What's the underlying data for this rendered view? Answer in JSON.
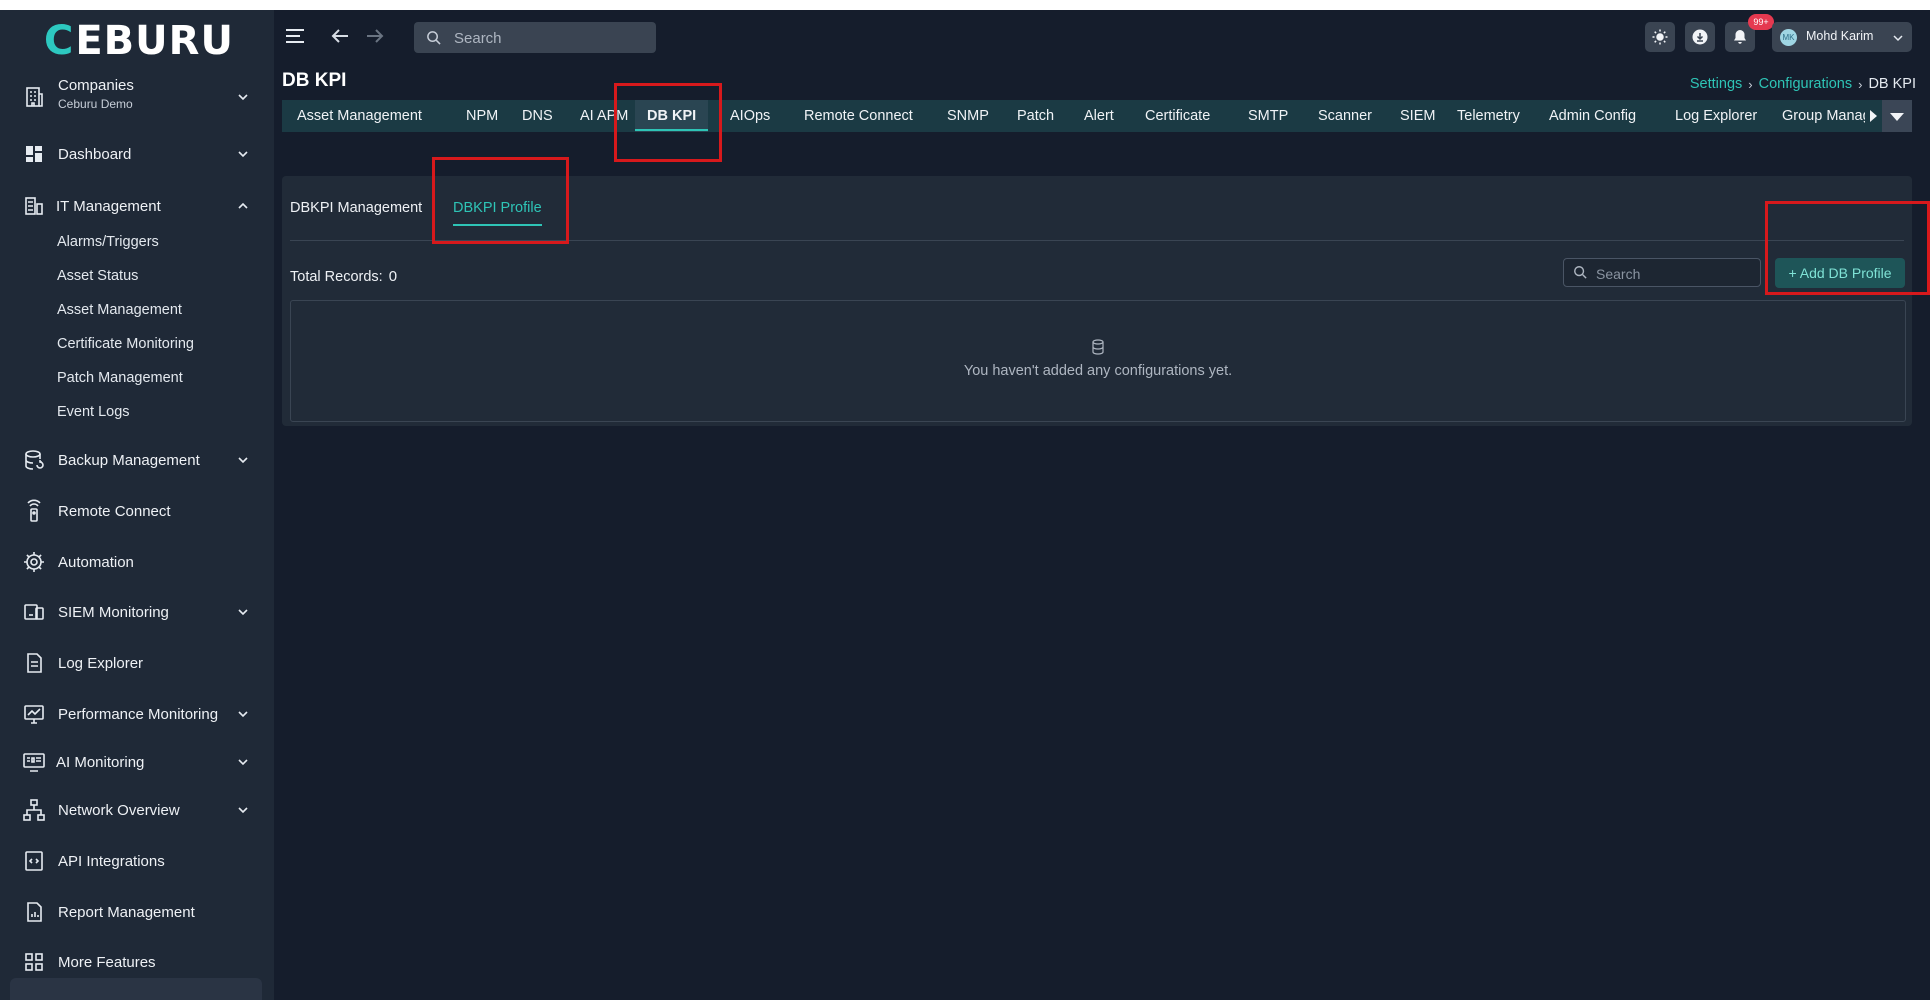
{
  "brand": {
    "logo_first": "C",
    "logo_rest": "EBURU"
  },
  "sidebar": {
    "companies": {
      "label": "Companies",
      "sub": "Ceburu Demo"
    },
    "items": [
      {
        "label": "Dashboard"
      },
      {
        "label": "IT Management"
      },
      {
        "label": "Backup Management"
      },
      {
        "label": "Remote Connect"
      },
      {
        "label": "Automation"
      },
      {
        "label": "SIEM Monitoring"
      },
      {
        "label": "Log Explorer"
      },
      {
        "label": "Performance Monitoring"
      },
      {
        "label": "AI Monitoring"
      },
      {
        "label": "Network Overview"
      },
      {
        "label": "API Integrations"
      },
      {
        "label": "Report Management"
      },
      {
        "label": "More Features"
      }
    ],
    "it_sub": [
      {
        "label": "Alarms/Triggers"
      },
      {
        "label": "Asset Status"
      },
      {
        "label": "Asset Management"
      },
      {
        "label": "Certificate Monitoring"
      },
      {
        "label": "Patch Management"
      },
      {
        "label": "Event Logs"
      }
    ]
  },
  "topbar": {
    "search_placeholder": "Search",
    "notification_count": "99+",
    "user_initials": "MK",
    "user_name": "Mohd Karim"
  },
  "page": {
    "title": "DB KPI",
    "breadcrumb": {
      "settings": "Settings",
      "configurations": "Configurations",
      "current": "DB KPI",
      "sep": "›"
    }
  },
  "tabs": [
    {
      "label": "Asset Management"
    },
    {
      "label": "NPM"
    },
    {
      "label": "DNS"
    },
    {
      "label": "AI APM"
    },
    {
      "label": "DB KPI",
      "active": true
    },
    {
      "label": "AIOps"
    },
    {
      "label": "Remote Connect"
    },
    {
      "label": "SNMP"
    },
    {
      "label": "Patch"
    },
    {
      "label": "Alert"
    },
    {
      "label": "Certificate"
    },
    {
      "label": "SMTP"
    },
    {
      "label": "Scanner"
    },
    {
      "label": "SIEM"
    },
    {
      "label": "Telemetry"
    },
    {
      "label": "Admin Config"
    },
    {
      "label": "Log Explorer"
    },
    {
      "label": "Group Manage"
    }
  ],
  "subtabs": {
    "management": "DBKPI Management",
    "profile": "DBKPI Profile"
  },
  "records": {
    "label": "Total Records:",
    "count": "0"
  },
  "panel": {
    "search_placeholder": "Search",
    "add_button": "+ Add DB Profile",
    "empty_message": "You haven't added any configurations yet."
  },
  "colors": {
    "accent": "#2ec4b6",
    "background": "#151d2c",
    "sidebar": "#1f2937",
    "annotation": "#d7191c"
  }
}
